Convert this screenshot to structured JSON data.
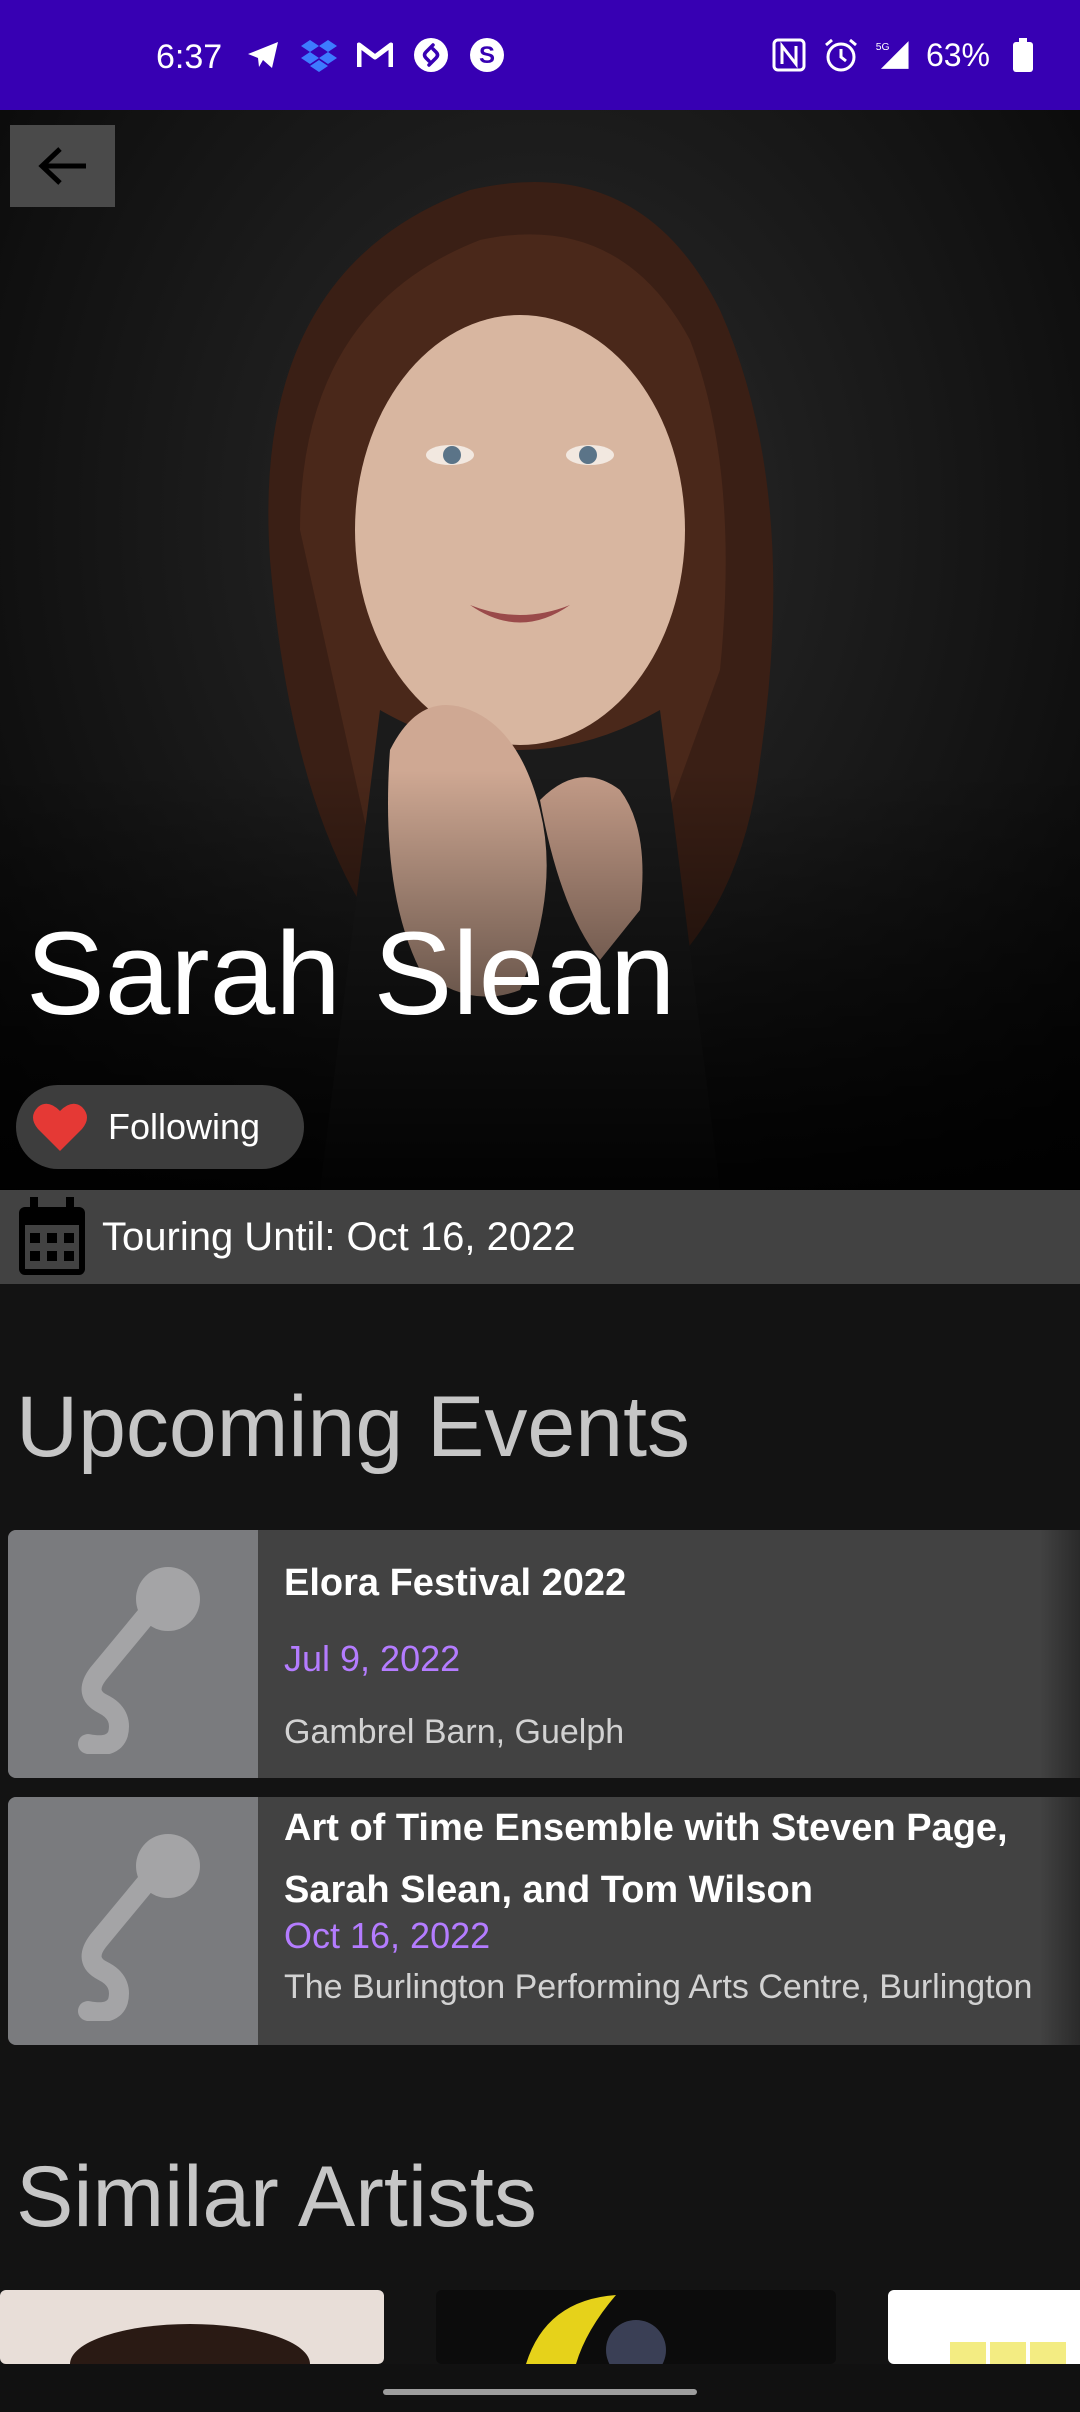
{
  "status_bar": {
    "time": "6:37",
    "battery": "63%",
    "left_icons": [
      "telegram-icon",
      "dropbox-icon",
      "gmail-icon",
      "shazam-icon",
      "s-app-icon"
    ],
    "right_icons": [
      "nfc-icon",
      "alarm-icon",
      "signal-5g-icon",
      "battery-icon"
    ]
  },
  "artist": {
    "name": "Sarah Slean",
    "follow_label": "Following",
    "touring_label": "Touring Until: Oct 16, 2022"
  },
  "sections": {
    "upcoming": "Upcoming Events",
    "similar": "Similar Artists"
  },
  "events": [
    {
      "title": "Elora Festival 2022",
      "date": "Jul 9, 2022",
      "venue": "Gambrel Barn, Guelph"
    },
    {
      "title": "Art of Time Ensemble with Steven Page, Sarah Slean, and Tom Wilson",
      "date": "Oct 16, 2022",
      "venue": "The Burlington Performing Arts Centre, Burlington"
    }
  ],
  "colors": {
    "status_bar": "#3700b3",
    "accent_date": "#b47cff",
    "heart": "#e53935"
  }
}
